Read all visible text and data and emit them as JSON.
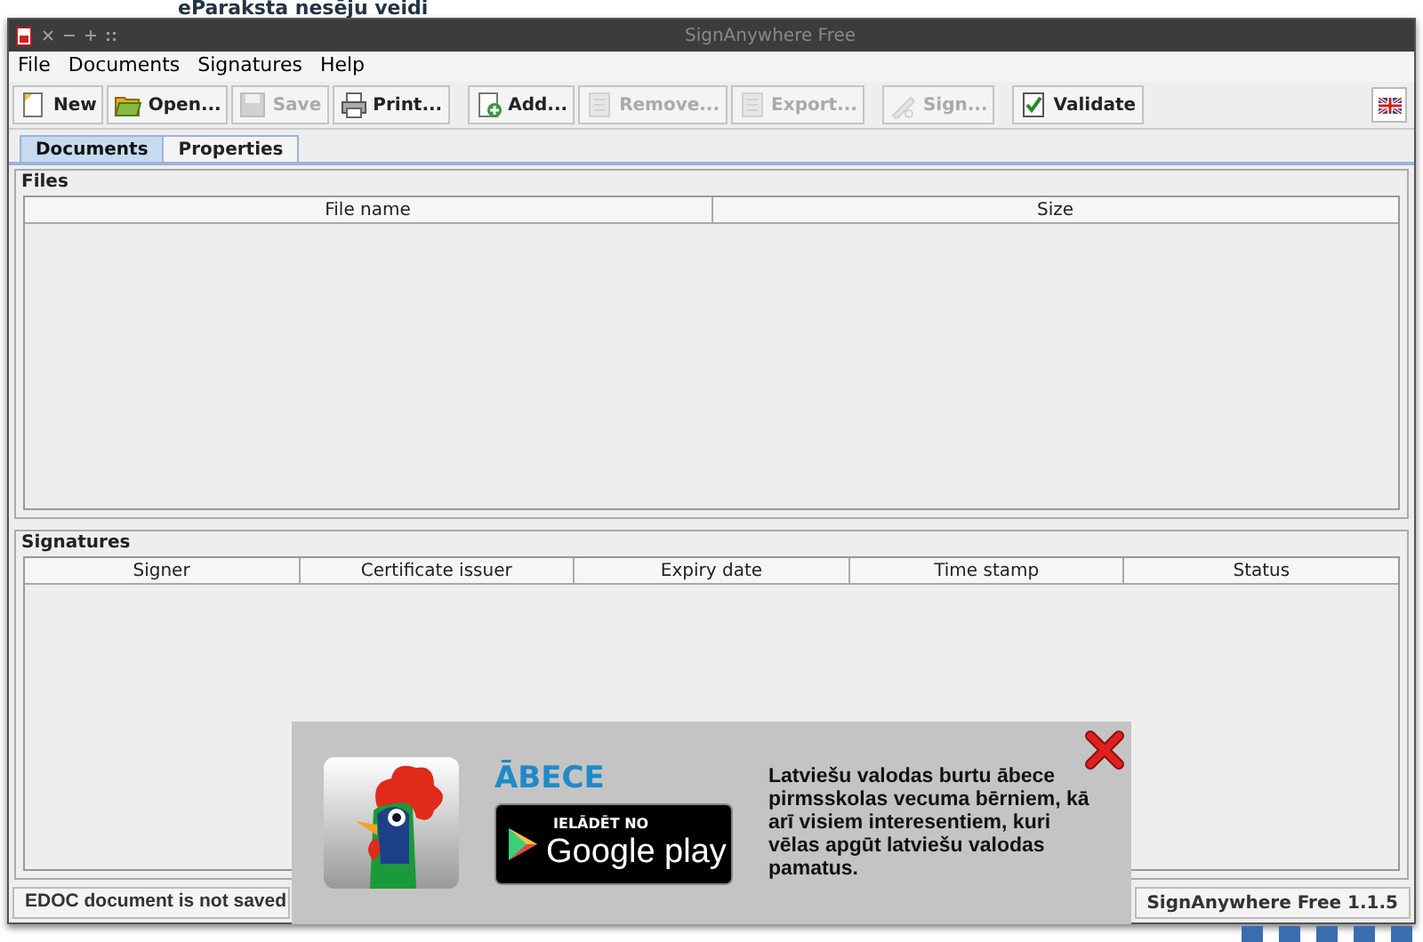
{
  "page_heading": "eParaksta nesēju veidi",
  "window": {
    "title": "SignAnywhere Free"
  },
  "menu": [
    "File",
    "Documents",
    "Signatures",
    "Help"
  ],
  "toolbar": [
    {
      "label": "New",
      "disabled": false
    },
    {
      "label": "Open...",
      "disabled": false
    },
    {
      "label": "Save",
      "disabled": true
    },
    {
      "label": "Print...",
      "disabled": false
    },
    {
      "label": "Add...",
      "disabled": false
    },
    {
      "label": "Remove...",
      "disabled": true
    },
    {
      "label": "Export...",
      "disabled": true
    },
    {
      "label": "Sign...",
      "disabled": true
    },
    {
      "label": "Validate",
      "disabled": false
    }
  ],
  "tabs": [
    {
      "label": "Documents",
      "selected": true
    },
    {
      "label": "Properties",
      "selected": false
    }
  ],
  "files": {
    "title": "Files",
    "columns": [
      "File name",
      "Size"
    ]
  },
  "signatures": {
    "title": "Signatures",
    "columns": [
      "Signer",
      "Certificate issuer",
      "Expiry date",
      "Time stamp",
      "Status"
    ]
  },
  "status_bar": {
    "left": "EDOC document is not saved",
    "right": "SignAnywhere Free 1.1.5"
  },
  "ad": {
    "app_name": "ĀBECE",
    "store_caption": "IELĀDĒT NO",
    "store_name": "Google play",
    "description": "Latviešu valodas burtu ābece pirmsskolas vecuma bērniem, kā arī visiem interesentiem, kuri vēlas apgūt latviešu valodas pamatus."
  }
}
